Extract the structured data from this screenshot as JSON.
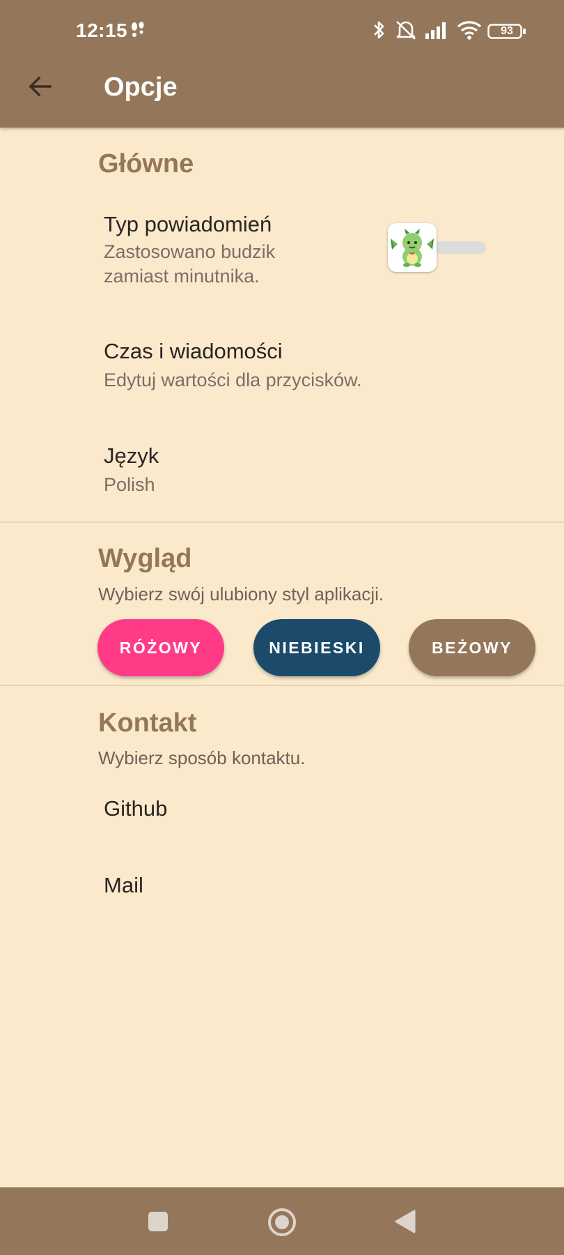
{
  "status_bar": {
    "time": "12:15",
    "battery": "93",
    "icons": [
      "steps-icon",
      "bluetooth-icon",
      "silent-alarm-icon",
      "signal-icon",
      "wifi-icon",
      "battery-icon"
    ]
  },
  "app_bar": {
    "title": "Opcje",
    "back_icon": "arrow-back-icon"
  },
  "sections": {
    "main": {
      "title": "Główne",
      "notification_type": {
        "title": "Typ powiadomień",
        "summary_line1": "Zastosowano budzik",
        "summary_line2": "zamiast minutnika.",
        "toggle_on": false,
        "thumb_icon": "dragon-icon"
      },
      "time_messages": {
        "title": "Czas i wiadomości",
        "summary": "Edytuj wartości dla przycisków."
      },
      "language": {
        "title": "Język",
        "summary": "Polish"
      }
    },
    "appearance": {
      "title": "Wygląd",
      "subtitle": "Wybierz swój ulubiony styl aplikacji.",
      "themes": [
        {
          "label": "RÓŻOWY",
          "color": "#ff3b87"
        },
        {
          "label": "NIEBIESKI",
          "color": "#1b4a6b"
        },
        {
          "label": "BEŻOWY",
          "color": "#94775a"
        }
      ]
    },
    "contact": {
      "title": "Kontakt",
      "subtitle": "Wybierz sposób kontaktu.",
      "items": [
        {
          "label": "Github"
        },
        {
          "label": "Mail"
        }
      ]
    }
  },
  "nav_bar": {
    "buttons": [
      "recents-square-icon",
      "home-circle-icon",
      "back-triangle-icon"
    ]
  },
  "colors": {
    "primary": "#94775a",
    "background": "#fbe9cc"
  }
}
